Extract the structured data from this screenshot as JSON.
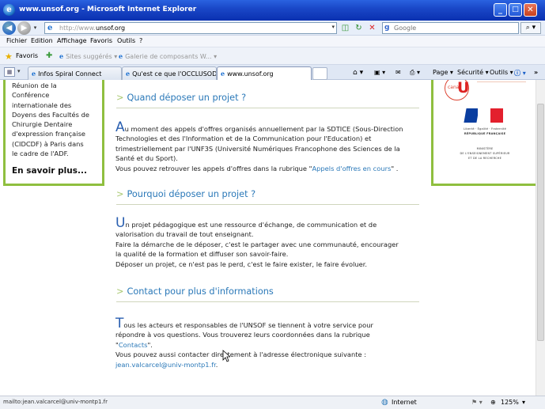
{
  "window": {
    "title": "www.unsof.org - Microsoft Internet Explorer",
    "minimize": "_",
    "maximize": "□",
    "close": "✕"
  },
  "address": {
    "url_prefix": "http://www.",
    "url_domain": "unsof.org",
    "search_placeholder": "Google",
    "search_engine_letter": "g"
  },
  "menu": [
    "Fichier",
    "Edition",
    "Affichage",
    "Favoris",
    "Outils",
    "?"
  ],
  "favorites": {
    "label": "Favoris",
    "items": [
      "Sites suggérés ▾",
      "Galerie de composants W... ▾"
    ]
  },
  "tabs": [
    {
      "label": "Infos Spiral Connect",
      "active": false
    },
    {
      "label": "Qu'est ce que l'OCCLUSODO...",
      "active": false
    },
    {
      "label": "www.unsof.org",
      "active": true
    }
  ],
  "commands": {
    "page": "Page ▾",
    "security": "Sécurité ▾",
    "tools": "Outils ▾"
  },
  "sidebar_left": {
    "text_lines": [
      "Réunion de la",
      "Conférence",
      "internationale des",
      "Doyens des Facultés de",
      "Chirurgie Dentaire",
      "d'expression française",
      "(CIDCDF) à Paris dans",
      "le cadre de l'ADF."
    ],
    "more_link": "En savoir plus..."
  },
  "sidebar_right": {
    "canal_c": "canal",
    "canal_u": "U",
    "rf_line1": "Liberté · Égalité · Fraternité",
    "rf_line2": "RÉPUBLIQUE FRANÇAISE",
    "ministry_line1": "MINISTÈRE",
    "ministry_line2": "DE L'ENSEIGNEMENT SUPÉRIEUR",
    "ministry_line3": "ET DE LA RECHERCHE"
  },
  "sections": [
    {
      "heading": "Quand déposer un projet ?",
      "cap": "A",
      "lines": [
        "u moment des appels d'offres organisés annuellement par la SDTICE (Sous-Direction",
        "Technologies et des l'Information et de la Communication pour l'Education) et",
        "trimestriellement par l'UNF3S (Université Numériques Francophone des Sciences de la",
        "Santé et du Sport)."
      ],
      "last_line_prefix": "Vous pouvez retrouver les appels d'offres dans la rubrique \"",
      "last_line_link": "Appels d'offres en cours",
      "last_line_suffix": "\" ."
    },
    {
      "heading": "Pourquoi déposer un projet ?",
      "cap": "U",
      "lines": [
        "n projet pédagogique est une ressource d'échange, de communication et de",
        "valorisation du travail de tout enseignant.",
        "Faire la démarche de le déposer, c'est le partager avec une communauté, encourager",
        "la qualité de la formation et diffuser son savoir-faire.",
        "Déposer un projet, ce n'est pas le perd, c'est le faire exister, le faire évoluer."
      ]
    },
    {
      "heading": "Contact pour plus d'informations",
      "cap": "T",
      "lines": [
        "ous les acteurs et responsables de l'UNSOF se tiennent à votre service pour",
        "répondre à vos questions. Vous trouverez leurs coordonnées dans la rubrique"
      ],
      "contacts_link": "Contacts",
      "contacts_suffix": "\".",
      "contact_line": "Vous pouvez aussi contacter directement à l'adresse électronique suivante :",
      "email": "jean.valcarcel@univ-montp1.fr",
      "email_suffix": "."
    }
  ],
  "status": {
    "url": "mailto:jean.valcarcel@univ-montp1.fr",
    "zone": "Internet",
    "zoom": "125%"
  }
}
